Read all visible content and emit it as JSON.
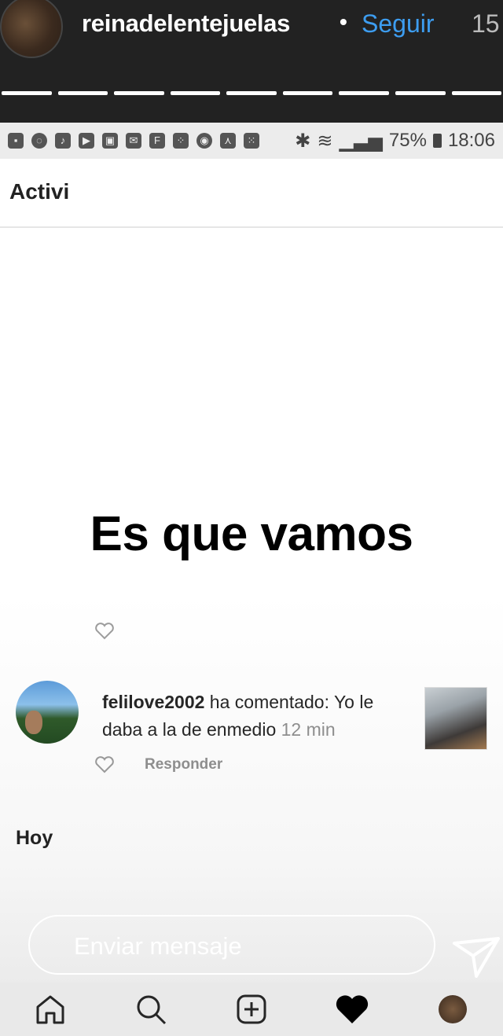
{
  "story": {
    "username": "reinadelentejuelas",
    "separator": "•",
    "follow_label": "Seguir",
    "time": "15",
    "progress_segments": 9
  },
  "status_bar": {
    "icons": [
      "message-icon",
      "whatsapp-icon",
      "tiktok-icon",
      "youtube-icon",
      "gallery-icon",
      "mail-icon",
      "flipboard-icon",
      "app-icon",
      "chrome-icon",
      "notification-icon",
      "app2-icon"
    ],
    "battery": "75%",
    "time": "18:06"
  },
  "screen": {
    "title": "Activi",
    "overlay_text": "Es que vamos",
    "comment": {
      "user": "felilove2002",
      "text": " ha comentado: Yo le daba a la de enmedio ",
      "time": "12 min",
      "reply_label": "Responder"
    },
    "section_today": "Hoy"
  },
  "reply": {
    "placeholder": "Enviar mensaje"
  },
  "nav": [
    "home-icon",
    "search-icon",
    "add-post-icon",
    "activity-heart-icon",
    "profile-avatar"
  ]
}
